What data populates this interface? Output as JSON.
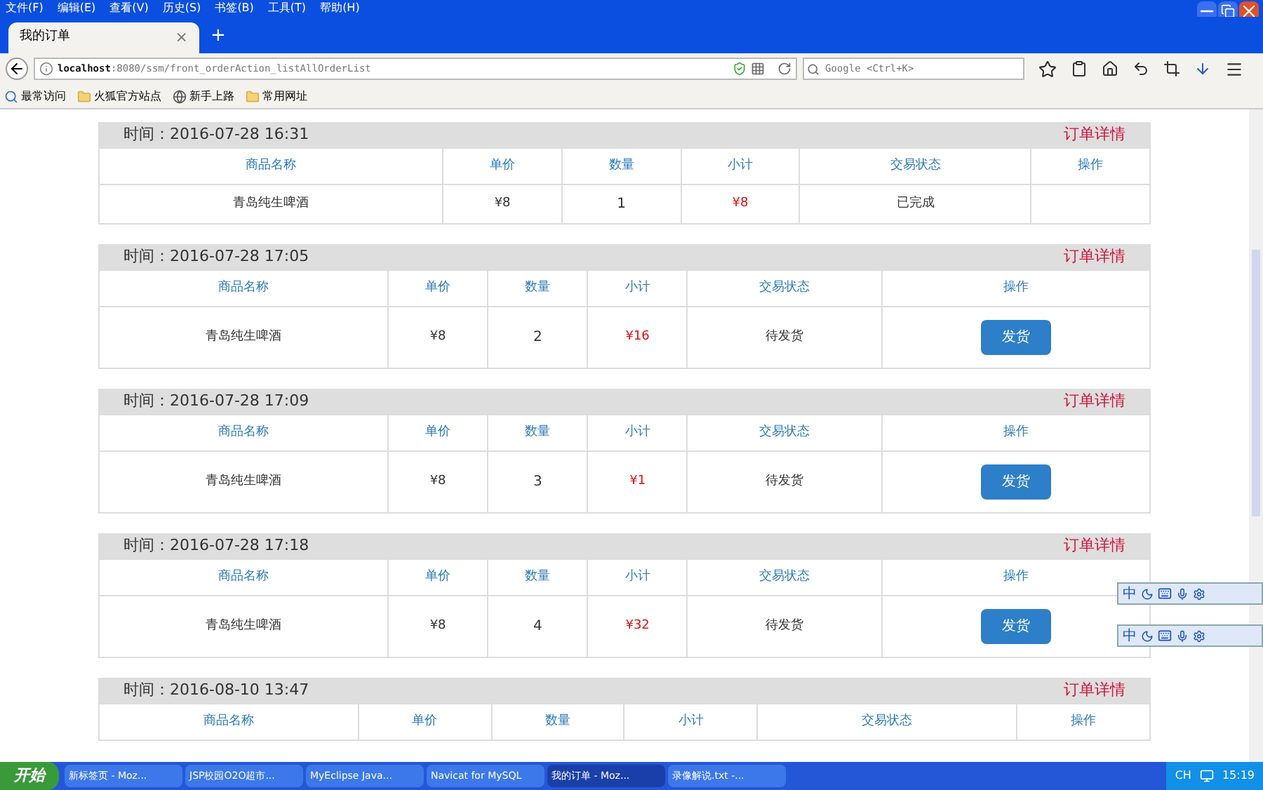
{
  "menu": [
    "文件(F)",
    "编辑(E)",
    "查看(V)",
    "历史(S)",
    "书签(B)",
    "工具(T)",
    "帮助(H)"
  ],
  "tabs": [
    {
      "label": "我的订单",
      "selected": true,
      "close": "×"
    }
  ],
  "new_tab": "+",
  "address": {
    "host": "localhost",
    "path": ":8080/ssm/front_orderAction_listAllOrderList"
  },
  "search": {
    "placeholder": "Google <Ctrl+K>"
  },
  "bookmarks": [
    {
      "label": "最常访问",
      "kind": "smart"
    },
    {
      "label": "火狐官方站点",
      "kind": "folder"
    },
    {
      "label": "新手上路",
      "kind": "globe"
    },
    {
      "label": "常用网址",
      "kind": "folder"
    }
  ],
  "orders": [
    {
      "time": "时间：2016-07-28 16:31",
      "detail": "订单详情",
      "columns": [
        "商品名称",
        "单价",
        "数量",
        "小计",
        "交易状态",
        "操作"
      ],
      "items": [
        {
          "name": "青岛纯生啤酒",
          "price": "¥8",
          "qty": "1",
          "subtotal": "¥8",
          "status": "已完成"
        }
      ]
    },
    {
      "time": "时间：2016-07-28 17:05",
      "detail": "订单详情",
      "columns": [
        "商品名称",
        "单价",
        "数量",
        "小计",
        "交易状态",
        "操作"
      ],
      "items": [
        {
          "name": "青岛纯生啤酒",
          "price": "¥8",
          "qty": "2",
          "subtotal": "¥16",
          "status": "待发货",
          "action": "发货"
        }
      ]
    },
    {
      "time": "时间：2016-07-28 17:09",
      "detail": "订单详情",
      "columns": [
        "商品名称",
        "单价",
        "数量",
        "小计",
        "交易状态",
        "操作"
      ],
      "items": [
        {
          "name": "青岛纯生啤酒",
          "price": "¥8",
          "qty": "3",
          "subtotal": "¥1",
          "status": "待发货",
          "action": "发货"
        }
      ]
    },
    {
      "time": "时间：2016-07-28 17:18",
      "detail": "订单详情",
      "columns": [
        "商品名称",
        "单价",
        "数量",
        "小计",
        "交易状态",
        "操作"
      ],
      "items": [
        {
          "name": "青岛纯生啤酒",
          "price": "¥8",
          "qty": "4",
          "subtotal": "¥32",
          "status": "待发货",
          "action": "发货"
        }
      ]
    },
    {
      "time": "时间：2016-08-10 13:47",
      "detail": "订单详情",
      "columns": [
        "商品名称",
        "单价",
        "数量",
        "小计",
        "交易状态",
        "操作"
      ]
    }
  ],
  "ime_bars": [
    {
      "label": "中"
    },
    {
      "label": "中"
    }
  ],
  "taskbar": {
    "start": "开始",
    "tasks": [
      {
        "label": "新标签页 - Moz...",
        "selected": false
      },
      {
        "label": "JSP校园O2O超市...",
        "selected": false
      },
      {
        "label": "MyEclipse Java...",
        "selected": false
      },
      {
        "label": "Navicat for MySQL",
        "selected": false
      },
      {
        "label": "我的订单 - Moz...",
        "selected": true
      },
      {
        "label": "录像解说.txt -...",
        "selected": false
      }
    ],
    "lang": "CH",
    "clock": "15:19"
  }
}
